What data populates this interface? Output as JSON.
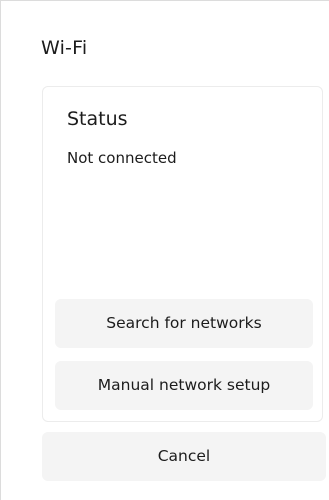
{
  "screen": {
    "title": "Wi-Fi"
  },
  "status": {
    "heading": "Status",
    "value": "Not connected"
  },
  "actions": {
    "search_label": "Search for networks",
    "manual_label": "Manual network setup",
    "cancel_label": "Cancel"
  }
}
